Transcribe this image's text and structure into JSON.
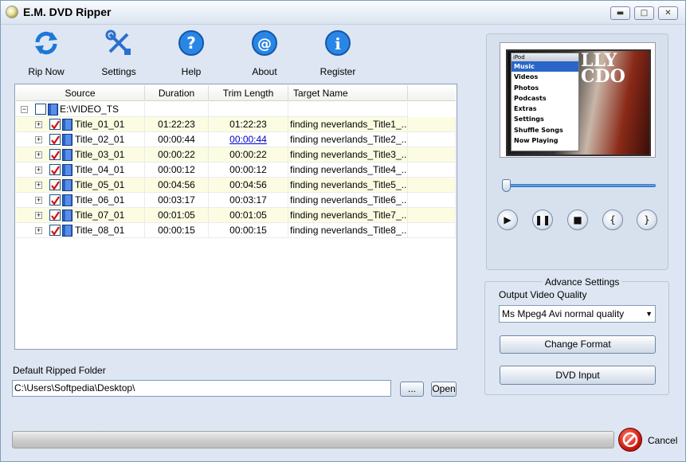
{
  "window": {
    "title": "E.M. DVD Ripper"
  },
  "window_buttons": {
    "minimize": "▬",
    "maximize": "□",
    "close": "✕"
  },
  "toolbar": {
    "rip_now": "Rip Now",
    "settings": "Settings",
    "help": "Help",
    "about": "About",
    "register": "Register"
  },
  "grid": {
    "columns": [
      "Source",
      "Duration",
      "Trim Length",
      "Target Name"
    ],
    "root": {
      "label": "E:\\VIDEO_TS"
    },
    "rows": [
      {
        "source": "Title_01_01",
        "duration": "01:22:23",
        "trim": "01:22:23",
        "target": "finding neverlands_Title1_..."
      },
      {
        "source": "Title_02_01",
        "duration": "00:00:44",
        "trim": "00:00:44",
        "target": "finding neverlands_Title2_..."
      },
      {
        "source": "Title_03_01",
        "duration": "00:00:22",
        "trim": "00:00:22",
        "target": "finding neverlands_Title3_..."
      },
      {
        "source": "Title_04_01",
        "duration": "00:00:12",
        "trim": "00:00:12",
        "target": "finding neverlands_Title4_..."
      },
      {
        "source": "Title_05_01",
        "duration": "00:04:56",
        "trim": "00:04:56",
        "target": "finding neverlands_Title5_..."
      },
      {
        "source": "Title_06_01",
        "duration": "00:03:17",
        "trim": "00:03:17",
        "target": "finding neverlands_Title6_..."
      },
      {
        "source": "Title_07_01",
        "duration": "00:01:05",
        "trim": "00:01:05",
        "target": "finding neverlands_Title7_..."
      },
      {
        "source": "Title_08_01",
        "duration": "00:00:15",
        "trim": "00:00:15",
        "target": "finding neverlands_Title8_..."
      }
    ]
  },
  "folder": {
    "label": "Default Ripped Folder",
    "value": "C:\\Users\\Softpedia\\Desktop\\",
    "browse": "...",
    "open": "Open"
  },
  "ipod": {
    "header": "iPod",
    "menu": [
      "Music",
      "Videos",
      "Photos",
      "Podcasts",
      "Extras",
      "Settings",
      "Shuffle Songs",
      "Now Playing"
    ],
    "overlay_text": "LLY\nCDO"
  },
  "advance": {
    "title": "Advance Settings",
    "quality_label": "Output Video Quality",
    "quality_value": "Ms Mpeg4 Avi normal quality",
    "change_format": "Change Format",
    "dvd_input": "DVD Input"
  },
  "progress": {
    "value": 0
  },
  "cancel": "Cancel",
  "colors": {
    "accent": "#0a246a",
    "panel": "#dde6f2",
    "alt_row": "#fcfce3"
  }
}
